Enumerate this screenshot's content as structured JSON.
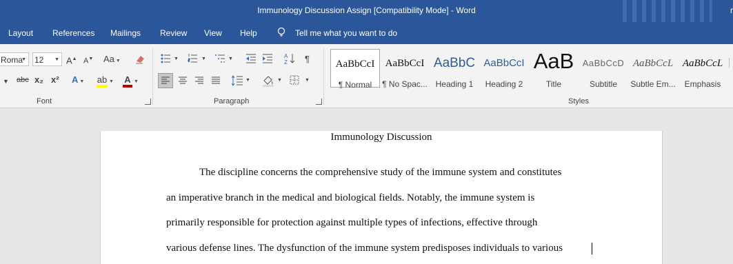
{
  "window": {
    "title": "Immunology Discussion Assign [Compatibility Mode]  -  Word",
    "user_initial": "r",
    "titlebar_color": "#2b579a"
  },
  "menu": {
    "tabs": [
      "Layout",
      "References",
      "Mailings",
      "Review",
      "View",
      "Help"
    ],
    "tell_me": "Tell me what you want to do",
    "tell_me_icon": "lightbulb-icon"
  },
  "ribbon": {
    "font": {
      "name": "Roma",
      "size": "12",
      "group_label": "Font",
      "case_label": "Aa",
      "strike_label": "abc",
      "sub_label": "x₂",
      "sup_label": "x²",
      "grow_label": "A",
      "shrink_label": "A",
      "font_color": "#c00000",
      "highlight_color": "#ffff00"
    },
    "paragraph": {
      "group_label": "Paragraph"
    },
    "styles": {
      "group_label": "Styles",
      "items": [
        {
          "preview": "AaBbCcI",
          "name": "¶ Normal"
        },
        {
          "preview": "AaBbCcI",
          "name": "¶ No Spac..."
        },
        {
          "preview": "AaBbC",
          "name": "Heading 1"
        },
        {
          "preview": "AaBbCcI",
          "name": "Heading 2"
        },
        {
          "preview": "AaB",
          "name": "Title"
        },
        {
          "preview": "AaBbCcD",
          "name": "Subtitle"
        },
        {
          "preview": "AaBbCcL",
          "name": "Subtle Em..."
        },
        {
          "preview": "AaBbCcL",
          "name": "Emphasis"
        }
      ]
    }
  },
  "document": {
    "title": "Immunology Discussion",
    "lines": [
      "The discipline concerns the comprehensive study of the immune system and constitutes",
      "an imperative branch in the medical and biological fields. Notably, the immune system is",
      "primarily responsible for protection against multiple types of infections, effective through",
      "various defense lines. The dysfunction of the immune system predisposes individuals to various"
    ]
  }
}
